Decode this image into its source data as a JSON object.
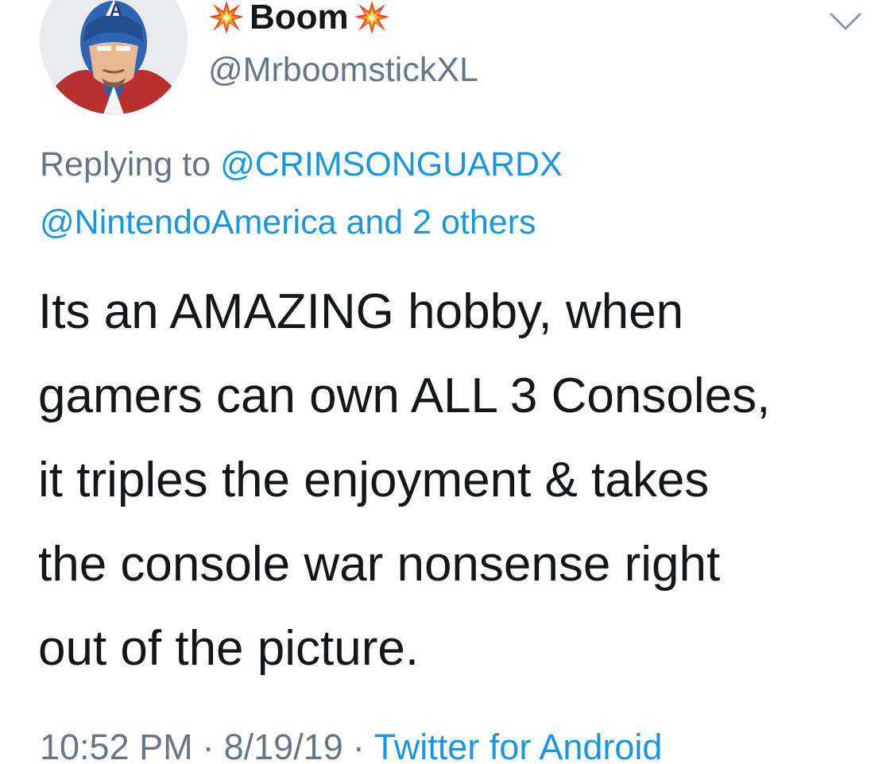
{
  "user": {
    "display_name": "Boom",
    "handle": "@MrboomstickXL",
    "name_emoji": "collision-icon"
  },
  "reply": {
    "prefix": "Replying to",
    "first_mention": "@CRIMSONGUARDX",
    "second_mention": "@NintendoAmerica",
    "and_text": "and",
    "others_text": "2 others"
  },
  "tweet": {
    "lines": [
      "Its an AMAZING hobby, when",
      "gamers can own ALL 3 Consoles,",
      "it triples the enjoyment & takes",
      "the console war nonsense right",
      "out of the picture."
    ]
  },
  "meta": {
    "time": "10:52 PM",
    "date": "8/19/19",
    "separator": "·",
    "source": "Twitter for Android"
  },
  "colors": {
    "text": "#14171a",
    "secondary": "#657786",
    "link": "#1b95e0"
  }
}
